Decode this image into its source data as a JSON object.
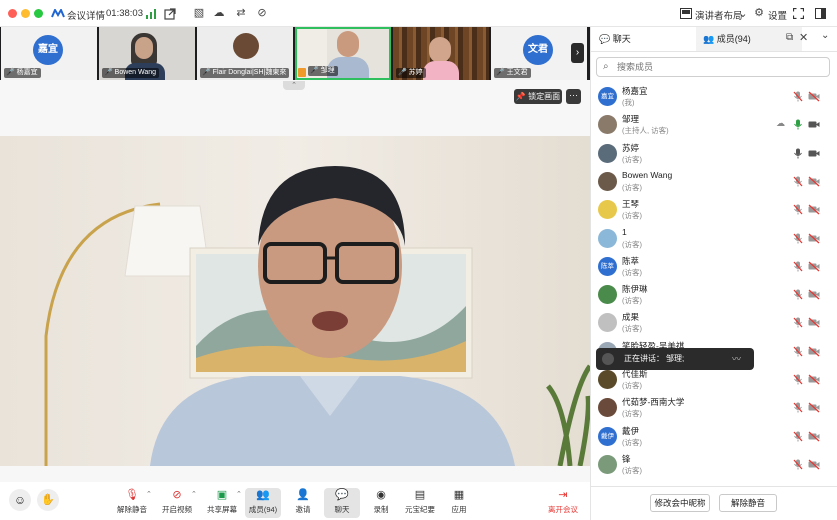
{
  "titlebar": {
    "meeting_details": "会议详情",
    "timer": "01:38:03",
    "layout_label": "演讲者布局",
    "settings_label": "设置"
  },
  "thumbnails": [
    {
      "name": "杨嘉宜",
      "avatar_text": "嘉宜",
      "type": "avatar",
      "color": "#2f6fd0"
    },
    {
      "name": "Bowen Wang",
      "type": "video"
    },
    {
      "name": "Flair Donglai|SH|魏東來",
      "type": "video"
    },
    {
      "name": "邹理",
      "type": "video",
      "active": true
    },
    {
      "name": "苏婷",
      "type": "video"
    },
    {
      "name": "王文君",
      "avatar_text": "文君",
      "type": "avatar",
      "color": "#2f6fd0"
    }
  ],
  "main": {
    "lock_label": "锁定画面",
    "more_label": "···"
  },
  "toolbar": {
    "items": [
      {
        "label": "解除静音",
        "icon": "mic-muted-icon"
      },
      {
        "label": "开启视频",
        "icon": "camera-off-icon"
      },
      {
        "label": "共享屏幕",
        "icon": "share-screen-icon"
      },
      {
        "label": "成员(94)",
        "icon": "members-icon",
        "active": true
      },
      {
        "label": "邀请",
        "icon": "invite-icon"
      },
      {
        "label": "聊天",
        "icon": "chat-icon",
        "active": true
      },
      {
        "label": "录制",
        "icon": "record-icon"
      },
      {
        "label": "元宝纪要",
        "icon": "notes-icon"
      },
      {
        "label": "应用",
        "icon": "apps-icon"
      }
    ],
    "leave_label": "离开会议",
    "leave_color": "#e53935"
  },
  "panel": {
    "chat_tab": "聊天",
    "members_tab": "成员(94)",
    "search_placeholder": "搜索成员",
    "members": [
      {
        "name": "杨嘉宜",
        "role": "(我)",
        "avatar": "嘉宜",
        "color": "#2f6fd0",
        "mic": "muted",
        "cam": "off"
      },
      {
        "name": "邹理",
        "role": "(主持人, 访客)",
        "avatar": "",
        "color": "#8a7a6a",
        "mic": "active",
        "cam": "on",
        "extra_icon": true
      },
      {
        "name": "苏婷",
        "role": "(访客)",
        "avatar": "",
        "color": "#5a6b7a",
        "mic": "on",
        "cam": "on"
      },
      {
        "name": "Bowen Wang",
        "role": "(访客)",
        "avatar": "",
        "color": "#6b5a4a",
        "mic": "muted",
        "cam": "off"
      },
      {
        "name": "王琴",
        "role": "(访客)",
        "avatar": "",
        "color": "#e8c84a",
        "mic": "muted",
        "cam": "off"
      },
      {
        "name": "1",
        "role": "(访客)",
        "avatar": "",
        "color": "#8bb8d8",
        "mic": "muted",
        "cam": "off"
      },
      {
        "name": "陈萃",
        "role": "(访客)",
        "avatar": "陈萃",
        "color": "#2f6fd0",
        "mic": "muted",
        "cam": "off"
      },
      {
        "name": "陈伊琳",
        "role": "(访客)",
        "avatar": "",
        "color": "#4a8a4a",
        "mic": "muted",
        "cam": "off"
      },
      {
        "name": "成果",
        "role": "(访客)",
        "avatar": "",
        "color": "#c0c0c0",
        "mic": "muted",
        "cam": "off"
      },
      {
        "name": "笑脸轻盈-吴美祺",
        "role": "(访客)",
        "avatar": "",
        "color": "#9aa7b5",
        "mic": "muted",
        "cam": "off"
      },
      {
        "name": "代佳斯",
        "role": "(访客)",
        "avatar": "",
        "color": "#5a4a2a",
        "mic": "muted",
        "cam": "off"
      },
      {
        "name": "代茹梦-西南大学",
        "role": "(访客)",
        "avatar": "",
        "color": "#6a4a3a",
        "mic": "muted",
        "cam": "off"
      },
      {
        "name": "戴伊",
        "role": "(访客)",
        "avatar": "戴伊",
        "color": "#2f6fd0",
        "mic": "muted",
        "cam": "off"
      },
      {
        "name": "锋",
        "role": "(访客)",
        "avatar": "",
        "color": "#7a9a7a",
        "mic": "muted",
        "cam": "off"
      }
    ],
    "speaking_label": "正在讲话：",
    "speaking_name": "邹理;",
    "rename_button": "修改会中昵称",
    "unmute_button": "解除静音"
  }
}
